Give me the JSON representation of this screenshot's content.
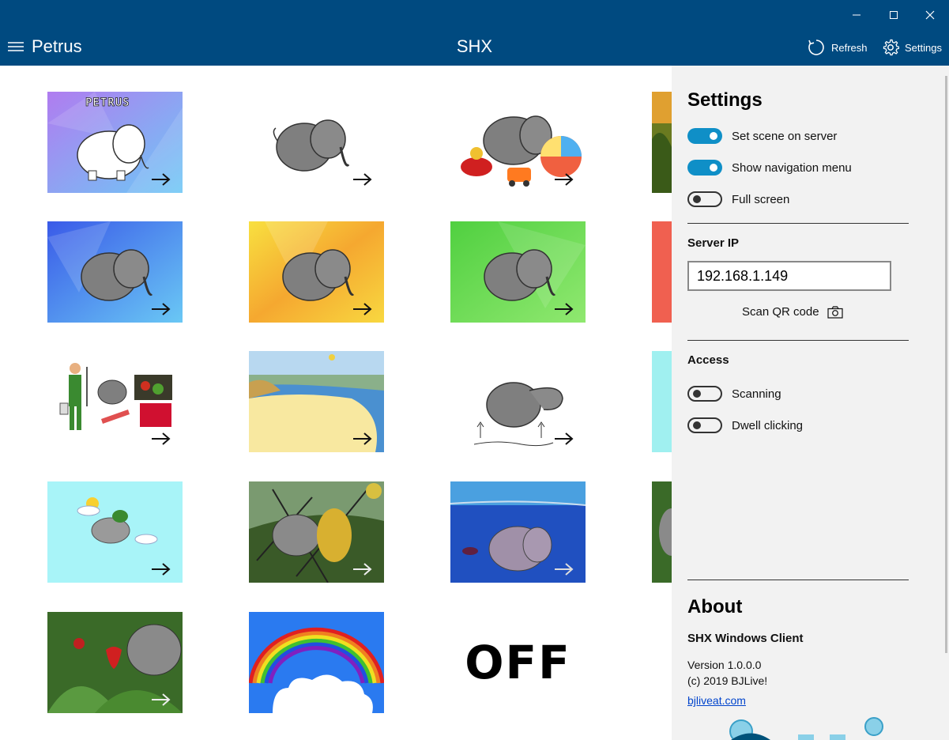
{
  "window": {
    "controls": [
      "minimize-icon",
      "maximize-icon",
      "close-icon"
    ]
  },
  "appbar": {
    "app_name": "Petrus",
    "title": "SHX",
    "refresh_label": "Refresh",
    "settings_label": "Settings",
    "background": "#004a80"
  },
  "tiles": {
    "r1c1_text": "PETRUS",
    "off_label": "OFF"
  },
  "settings": {
    "title": "Settings",
    "toggles": [
      {
        "label": "Set scene on server",
        "on": true
      },
      {
        "label": "Show navigation menu",
        "on": true
      },
      {
        "label": "Full screen",
        "on": false
      }
    ],
    "server_ip_label": "Server IP",
    "server_ip_value": "192.168.1.149",
    "scan_qr_label": "Scan QR code",
    "access_label": "Access",
    "access_toggles": [
      {
        "label": "Scanning",
        "on": false
      },
      {
        "label": "Dwell clicking",
        "on": false
      }
    ],
    "toggle_on_color": "#0f8fc7"
  },
  "about": {
    "title": "About",
    "product": "SHX Windows Client",
    "version": "Version 1.0.0.0",
    "copyright": "(c) 2019 BJLive!",
    "link": "bjliveat.com"
  }
}
